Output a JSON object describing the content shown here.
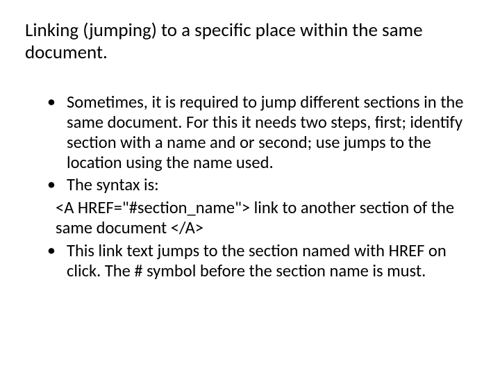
{
  "title": "Linking (jumping) to a specific place within the same document.",
  "bullets": {
    "b1": "Sometimes, it is required to jump different sections in the same document. For this it needs two steps, first; identify section with a name and or second; use jumps to the location using the name used.",
    "b2": "The syntax is:",
    "code": "<A HREF=\"#section_name\"> link to another section of the same document </A>",
    "b3": "This link text jumps to the section named with HREF on click. The # symbol before the section name is must."
  }
}
